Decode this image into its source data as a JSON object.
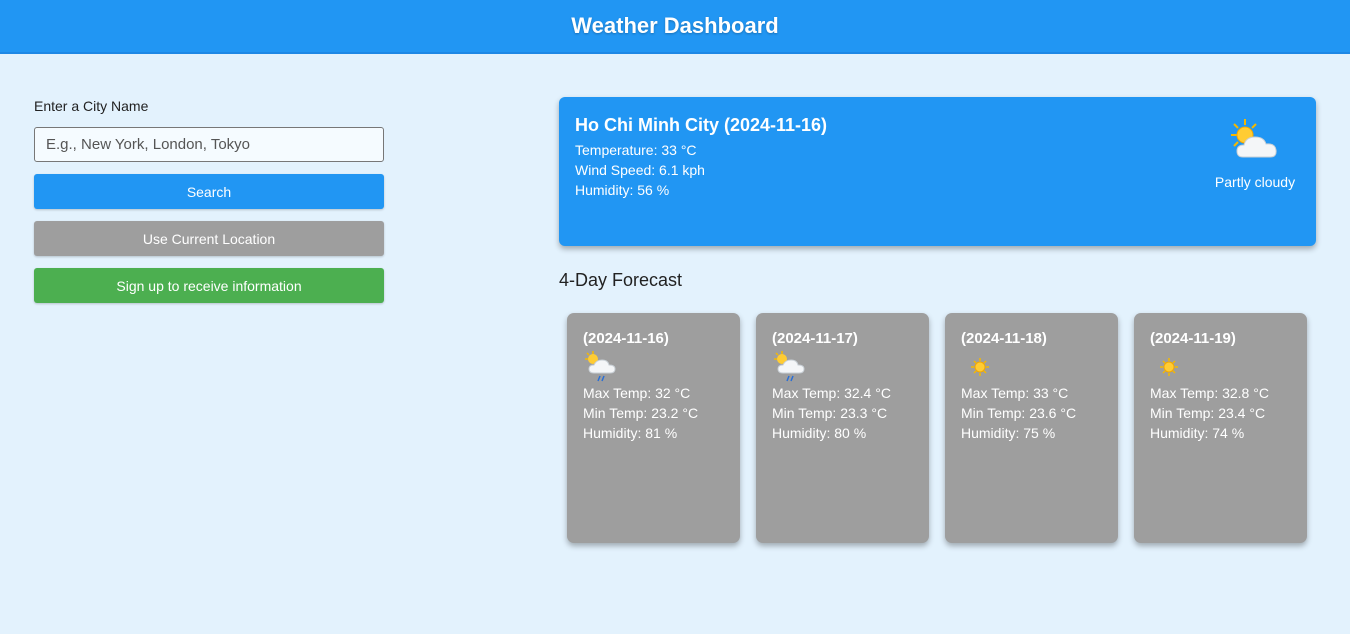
{
  "header": {
    "title": "Weather Dashboard"
  },
  "search": {
    "label": "Enter a City Name",
    "placeholder": "E.g., New York, London, Tokyo",
    "value": "",
    "search_label": "Search",
    "location_label": "Use Current Location",
    "signup_label": "Sign up to receive information"
  },
  "current": {
    "title": "Ho Chi Minh City (2024-11-16)",
    "temperature": "Temperature: 33 °C",
    "wind": "Wind Speed: 6.1 kph",
    "humidity": "Humidity: 56 %",
    "icon": "partly-cloudy-icon",
    "condition": "Partly cloudy"
  },
  "forecast": {
    "title": "4-Day Forecast",
    "days": [
      {
        "date": "(2024-11-16)",
        "icon": "patchy-rain-icon",
        "max": "Max Temp: 32 °C",
        "min": "Min Temp: 23.2 °C",
        "humidity": "Humidity: 81 %"
      },
      {
        "date": "(2024-11-17)",
        "icon": "patchy-rain-icon",
        "max": "Max Temp: 32.4 °C",
        "min": "Min Temp: 23.3 °C",
        "humidity": "Humidity: 80 %"
      },
      {
        "date": "(2024-11-18)",
        "icon": "sunny-icon",
        "max": "Max Temp: 33 °C",
        "min": "Min Temp: 23.6 °C",
        "humidity": "Humidity: 75 %"
      },
      {
        "date": "(2024-11-19)",
        "icon": "sunny-icon",
        "max": "Max Temp: 32.8 °C",
        "min": "Min Temp: 23.4 °C",
        "humidity": "Humidity: 74 %"
      }
    ]
  },
  "colors": {
    "primary": "#2196f3",
    "secondary": "#9e9e9e",
    "success": "#4caf50",
    "background": "#e3f2fd"
  }
}
